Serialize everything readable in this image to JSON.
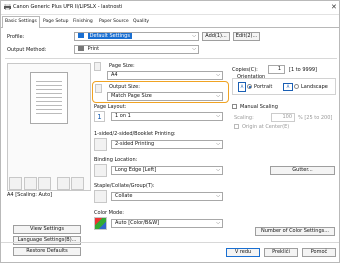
{
  "window": {
    "title": "Canon Generic Plus UFR II/LIPSLX - lastnosti"
  },
  "tabs": [
    {
      "label": "Basic Settings"
    },
    {
      "label": "Page Setup"
    },
    {
      "label": "Finishing"
    },
    {
      "label": "Paper Source"
    },
    {
      "label": "Quality"
    }
  ],
  "profile": {
    "label": "Profile:",
    "value": "Default Settings",
    "add": "Add(1)...",
    "edit": "Edit(2)..."
  },
  "output_method": {
    "label": "Output Method:",
    "value": "Print"
  },
  "preview": {
    "caption": "A4 [Scaling: Auto]"
  },
  "left_buttons": {
    "view": "View Settings",
    "language": "Language Settings(B)...",
    "restore": "Restore Defaults"
  },
  "page_size": {
    "label": "Page Size:",
    "value": "A4"
  },
  "output_size": {
    "label": "Output Size:",
    "value": "Match Page Size",
    "highlight_color": "#f0a323"
  },
  "copies": {
    "label": "Copies(C):",
    "value": "1",
    "range": "[1 to 9999]"
  },
  "orientation": {
    "label": "Orientation",
    "portrait": "Portrait",
    "landscape": "Landscape",
    "selected": "Portrait"
  },
  "page_layout": {
    "label": "Page Layout:",
    "value": "1 on 1"
  },
  "manual_scaling": {
    "label": "Manual Scaling",
    "scaling_label": "Scaling:",
    "scaling_value": "100",
    "scaling_range": "% [25 to 200]",
    "origin": "Origin at Center(E)"
  },
  "sided": {
    "label": "1-sided/2-sided/Booklet Printing:",
    "value": "2-sided Printing"
  },
  "binding": {
    "label": "Binding Location:",
    "value": "Long Edge [Left]",
    "gutter": "Gutter..."
  },
  "staple": {
    "label": "Staple/Collate/Group(T):",
    "value": "Collate"
  },
  "color_mode": {
    "label": "Color Mode:",
    "value": "Auto [Color/B&W]",
    "number_colors": "Number of Color Settings..."
  },
  "footer": {
    "ok": "V redu",
    "cancel": "Prekliči",
    "help": "Pomoč"
  }
}
